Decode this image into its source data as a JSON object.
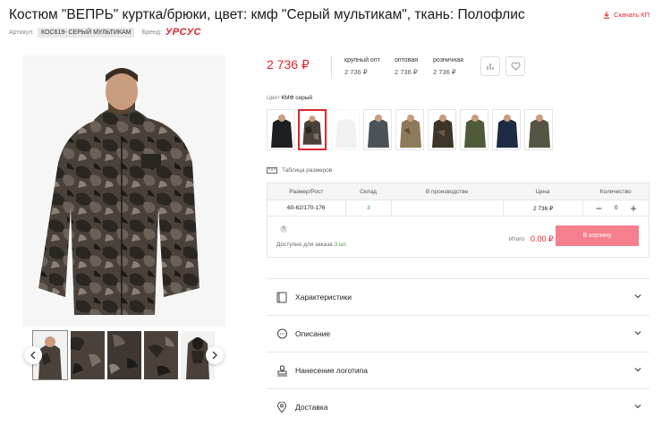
{
  "product": {
    "title": "Костюм \"ВЕПРЬ\" куртка/брюки, цвет: кмф \"Серый мультикам\", ткань: Полофлис",
    "download_label": "Скачать КП",
    "article_label": "Артикул:",
    "article_value": "КОС619- СЕРЫЙ МУЛЬТИКАМ",
    "brand_label": "Бренд:",
    "brand_logo_text": "УРСУС"
  },
  "pricing": {
    "main_price": "2 736 ₽",
    "columns": [
      {
        "label": "крупный опт",
        "value": "2 736 ₽"
      },
      {
        "label": "оптовая",
        "value": "2 736 ₽"
      },
      {
        "label": "розничная",
        "value": "2 736 ₽"
      }
    ],
    "compare_icon": "bar-chart-icon",
    "favorite_icon": "heart-icon"
  },
  "color": {
    "label": "Цвет",
    "selected": "КМФ серый",
    "swatch_count": 9,
    "selected_index": 1
  },
  "size_table": {
    "link_label": "Таблица размеров",
    "headers": [
      "Размер/Рост",
      "Склад",
      "В производстве",
      "Цена",
      "Количество"
    ],
    "rows": [
      {
        "size": "60-62/170-176",
        "stock": "3",
        "production": "",
        "price": "2 736 ₽",
        "qty": "0"
      }
    ],
    "help_mark": "?",
    "available_prefix": "Доступно для заказа",
    "available_count": "3 шт.",
    "total_label": "Итого",
    "total_value": "0.00 ₽",
    "cart_button": "В корзину"
  },
  "accordion": [
    {
      "label": "Характеристики",
      "icon": "book-icon"
    },
    {
      "label": "Описание",
      "icon": "chat-icon"
    },
    {
      "label": "Нанесение логотипа",
      "icon": "stamp-icon"
    },
    {
      "label": "Доставка",
      "icon": "location-icon"
    }
  ],
  "colors": {
    "accent": "#e0262f",
    "cart_button": "#f57f8c",
    "stock_green": "#3a9a36"
  }
}
